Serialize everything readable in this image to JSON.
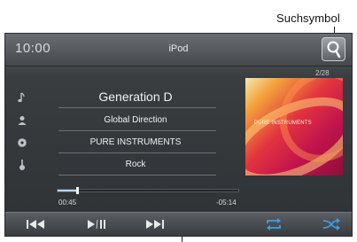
{
  "callout": {
    "label": "Suchsymbol"
  },
  "header": {
    "clock": "10:00",
    "source": "iPod"
  },
  "track_count": "2/28",
  "track": {
    "title": "Generation D",
    "artist": "Global Direction",
    "album": "PURE INSTRUMENTS",
    "genre": "Rock"
  },
  "album_art": {
    "text": "PURE INSTRUMENTS"
  },
  "progress": {
    "fraction": 0.11,
    "elapsed": "00:45",
    "remaining": "-05:14"
  },
  "controls": {
    "accent_color": "#3aa0e8",
    "icon_color": "#e8eaec"
  },
  "icons": {
    "search": "search-icon",
    "title": "music-note-icon",
    "artist": "person-icon",
    "album": "disc-icon",
    "genre": "guitar-icon",
    "prev": "previous-track-icon",
    "playpause": "play-pause-icon",
    "next": "next-track-icon",
    "repeat": "repeat-icon",
    "shuffle": "shuffle-icon"
  }
}
